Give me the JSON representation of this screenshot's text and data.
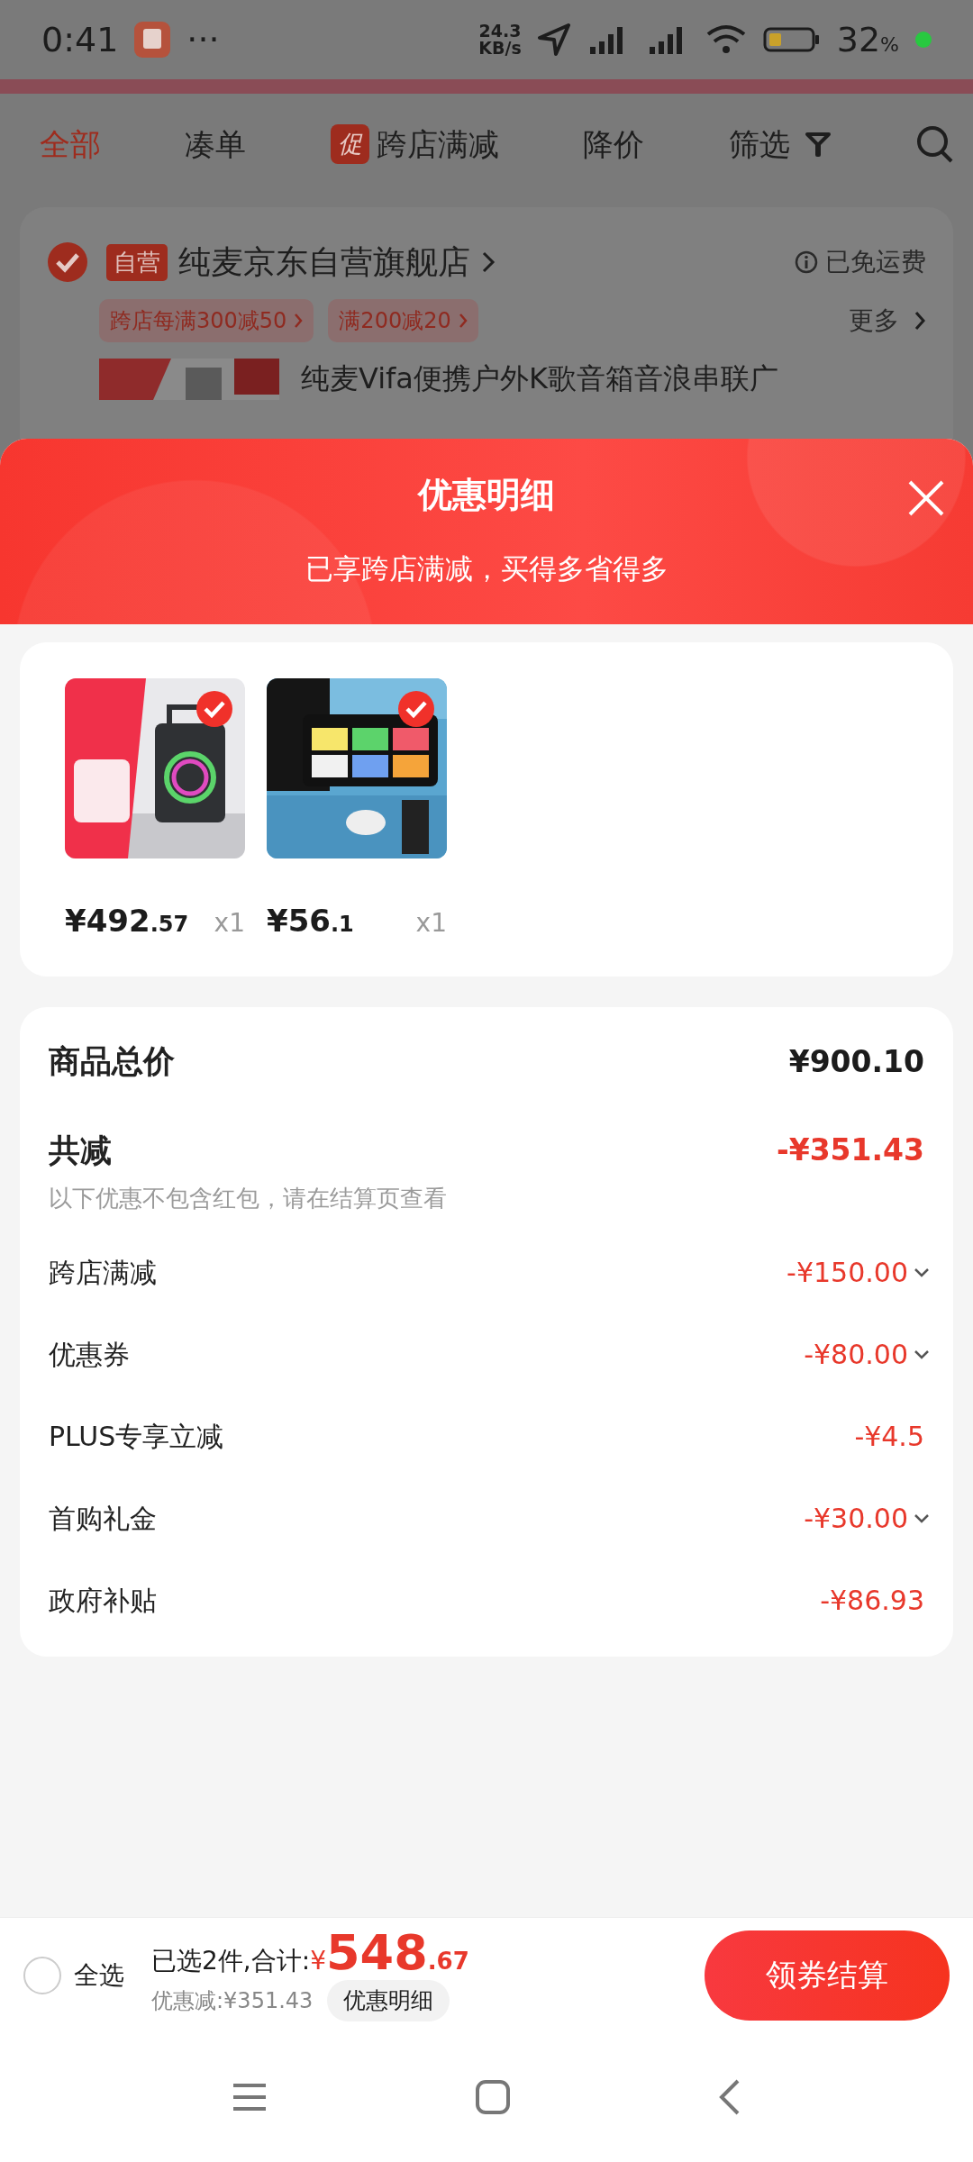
{
  "status_bar": {
    "time": "0:41",
    "more": "···",
    "speed_value": "24.3",
    "speed_unit": "KB/s",
    "battery_percent": "32",
    "battery_unit": "%"
  },
  "filter_tabs": [
    {
      "label": "全部",
      "selected": true,
      "kind": "plain"
    },
    {
      "label": "凑单",
      "selected": false,
      "kind": "plain"
    },
    {
      "label": "跨店满减",
      "selected": false,
      "kind": "badge",
      "badge": "促"
    },
    {
      "label": "降价",
      "selected": false,
      "kind": "plain"
    },
    {
      "label": "筛选",
      "selected": false,
      "kind": "filter"
    }
  ],
  "store": {
    "checked": true,
    "tag": "自营",
    "name": "纯麦京东自营旗舰店",
    "shipping": "已免运费",
    "promos": [
      "跨店每满300减50",
      "满200减20"
    ],
    "more": "更多",
    "product_title": "纯麦Vifa便携户外K歌音箱音浪串联广"
  },
  "sheet": {
    "title": "优惠明细",
    "subtitle": "已享跨店满减，买得多省得多"
  },
  "items": [
    {
      "checked": true,
      "price_main": "¥492",
      "price_decimal": ".57",
      "quantity": "x1",
      "kind": "speaker"
    },
    {
      "checked": true,
      "price_main": "¥56",
      "price_decimal": ".1",
      "quantity": "x1",
      "kind": "paints"
    }
  ],
  "summary": {
    "total_label": "商品总价",
    "total_value": "¥900.10",
    "discount_label": "共减",
    "discount_value": "-¥351.43",
    "note": "以下优惠不包含红包，请在结算页查看",
    "rows": [
      {
        "label": "跨店满减",
        "value": "-¥150.00",
        "expandable": true
      },
      {
        "label": "优惠券",
        "value": "-¥80.00",
        "expandable": true
      },
      {
        "label": "PLUS专享立减",
        "value": "-¥4.5",
        "expandable": false
      },
      {
        "label": "首购礼金",
        "value": "-¥30.00",
        "expandable": true
      },
      {
        "label": "政府补贴",
        "value": "-¥86.93",
        "expandable": false
      }
    ]
  },
  "bottom_bar": {
    "select_all_label": "全选",
    "select_all_checked": false,
    "selected_text": "已选2件,合计:",
    "currency": "¥",
    "amount_main": "548",
    "amount_decimal": ".67",
    "discount_text": "优惠减:¥351.43",
    "detail_button": "优惠明细",
    "checkout_button": "领券结算"
  }
}
